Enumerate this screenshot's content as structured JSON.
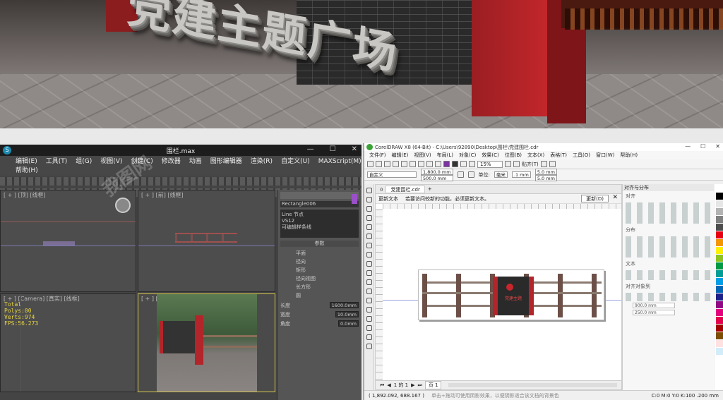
{
  "render": {
    "title_3d": "党建主题广场"
  },
  "max": {
    "window_title": "围栏.max",
    "menu": [
      "编辑(E)",
      "工具(T)",
      "组(G)",
      "视图(V)",
      "创建(C)",
      "修改器",
      "动画",
      "图形编辑器",
      "渲染(R)",
      "自定义(U)",
      "MAXScript(M)",
      "帮助(H)"
    ],
    "viewports": {
      "top": "[ + ] [顶] [线框]",
      "front": "[ + ] [前] [线框]",
      "left": "[ + ] [Camera] [真实] [线框]",
      "persp": "[ + ] [透视] [真实]"
    },
    "stats": {
      "line1": "Total",
      "line2": "Polys:00",
      "line3": "Verts:974",
      "line4": "FPS:56.273"
    },
    "command_panel": {
      "object_name": "Rectangle006",
      "list_items": [
        "Line 节点",
        "VS12",
        "可编辑样条线"
      ],
      "rollout_header": "参数",
      "options": [
        "平面",
        "径向",
        "矩形",
        "径向视图",
        "长方形",
        "圆"
      ],
      "fields": [
        {
          "label": "长度",
          "value": "1600.0mm"
        },
        {
          "label": "宽度",
          "value": "10.0mm"
        },
        {
          "label": "角度",
          "value": "0.0mm"
        }
      ]
    }
  },
  "corel": {
    "window_title": "CorelDRAW X8 (64-Bit) - C:\\Users\\92890\\Desktop\\围栏\\党建围栏.cdr",
    "menu": [
      "文件(F)",
      "编辑(E)",
      "视图(V)",
      "布局(L)",
      "对象(C)",
      "效果(C)",
      "位图(B)",
      "文本(X)",
      "表格(T)",
      "工具(O)",
      "窗口(W)",
      "帮助(H)"
    ],
    "zoom": "15%",
    "snap": "贴齐(T)",
    "preset": "自定义",
    "width": "1,800.0 mm",
    "height": "500.0 mm",
    "units_label": "单位:",
    "units": "毫米",
    "nudge": ".1 mm",
    "dup_x": "5.0 mm",
    "dup_y": "5.0 mm",
    "doc_tab": "党建围栏.cdr",
    "notice_label": "更新文本",
    "notice_text": "若要访问较新的功能，必须更新文本。",
    "update_button": "更新(D)",
    "board_text": "党建主题",
    "page_nav": "1 的 1",
    "page_tab": "页 1",
    "status_coords": "( 1,892.092, 688.167 )",
    "status_hint": "单击+拖动可使用阴影效果，以便阴影适合该文档的背景色",
    "status_fill": "C:0 M:0 Y:0 K:100 .200 mm",
    "dock_title": "对齐与分布",
    "dock_sections": [
      "对齐",
      "分布",
      "文本",
      "对齐对象到"
    ],
    "dock_fields": {
      "x": "900.0 mm",
      "y": "250.0 mm"
    },
    "palette": [
      "#ffffff",
      "#000000",
      "#e6e6e6",
      "#b3b3b3",
      "#808080",
      "#4d4d4d",
      "#e60012",
      "#f39800",
      "#fff100",
      "#8fc31f",
      "#009944",
      "#009e96",
      "#00a0e9",
      "#0068b7",
      "#1d2088",
      "#920783",
      "#e4007f",
      "#e5004f",
      "#a40000",
      "#7d4d00",
      "#ffe1e1",
      "#d3ecf9"
    ]
  }
}
